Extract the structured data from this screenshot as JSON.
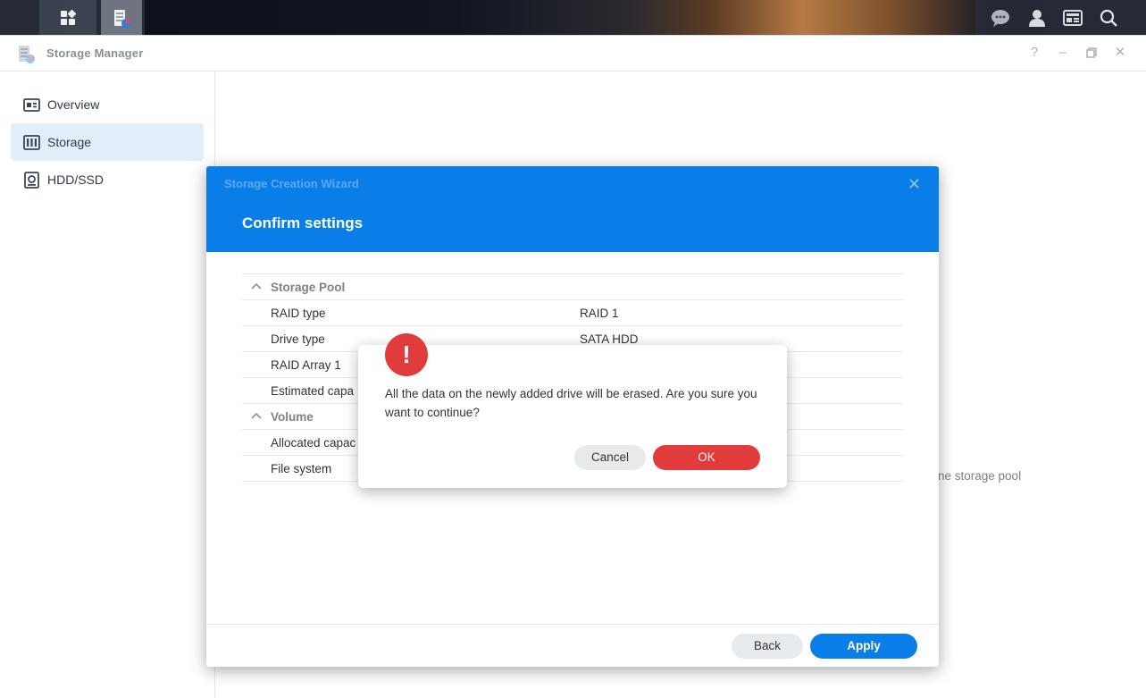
{
  "window": {
    "title": "Storage Manager"
  },
  "sidebar": {
    "items": [
      {
        "label": "Overview",
        "icon": "overview-icon"
      },
      {
        "label": "Storage",
        "icon": "storage-icon",
        "active": true
      },
      {
        "label": "HDD/SSD",
        "icon": "hdd-icon"
      }
    ]
  },
  "background": {
    "hint_text": "ne storage pool"
  },
  "wizard": {
    "subtitle": "Storage Creation Wizard",
    "title": "Confirm settings",
    "storage_pool_label": "Storage Pool",
    "rows_pool": [
      {
        "key": "RAID type",
        "value": "RAID 1"
      },
      {
        "key": "Drive type",
        "value": "SATA HDD"
      },
      {
        "key": "RAID Array 1",
        "value": ""
      },
      {
        "key": "Estimated capa",
        "value": ""
      }
    ],
    "volume_label": "Volume",
    "rows_volume": [
      {
        "key": "Allocated capac",
        "value": ""
      },
      {
        "key": "File system",
        "value": ""
      }
    ],
    "back_label": "Back",
    "apply_label": "Apply"
  },
  "alert": {
    "icon": "!",
    "message": "All the data on the newly added drive will be erased. Are you sure you want to continue?",
    "cancel_label": "Cancel",
    "ok_label": "OK"
  },
  "colors": {
    "accent": "#0a7ee8",
    "danger": "#e23b3b"
  }
}
